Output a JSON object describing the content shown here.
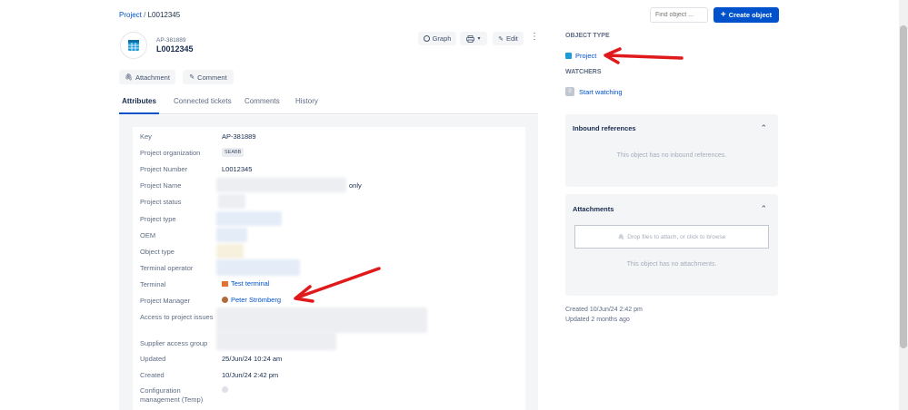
{
  "breadcrumb": {
    "parent": "Project",
    "separator": "/",
    "current": "L0012345"
  },
  "search": {
    "placeholder": "Find object ..."
  },
  "create_button": {
    "label": "Create object"
  },
  "object": {
    "key": "AP-381889",
    "name": "L0012345"
  },
  "toolbar": {
    "graph": "Graph",
    "edit": "Edit"
  },
  "actions": {
    "attachment": "Attachment",
    "comment": "Comment"
  },
  "tabs": [
    {
      "label": "Attributes",
      "active": true
    },
    {
      "label": "Connected tickets",
      "active": false
    },
    {
      "label": "Comments",
      "active": false
    },
    {
      "label": "History",
      "active": false
    }
  ],
  "attributes": {
    "key": {
      "label": "Key",
      "value": "AP-381889"
    },
    "org": {
      "label": "Project organization",
      "value": "SEABB"
    },
    "number": {
      "label": "Project Number",
      "value": "L0012345"
    },
    "name": {
      "label": "Project Name",
      "value_suffix": "only"
    },
    "status": {
      "label": "Project status"
    },
    "type": {
      "label": "Project type"
    },
    "oem": {
      "label": "OEM"
    },
    "object_type": {
      "label": "Object type"
    },
    "terminal_operator": {
      "label": "Terminal operator"
    },
    "terminal": {
      "label": "Terminal",
      "value": "Test terminal"
    },
    "manager": {
      "label": "Project Manager",
      "value": "Peter Strömberg"
    },
    "access": {
      "label": "Access to project issues"
    },
    "supplier": {
      "label": "Supplier access group"
    },
    "updated": {
      "label": "Updated",
      "value": "25/Jun/24 10:24 am"
    },
    "created": {
      "label": "Created",
      "value": "10/Jun/24 2:42 pm"
    },
    "config": {
      "label_line1": "Configuration",
      "label_line2": "management (Temp)"
    }
  },
  "sidebar": {
    "object_type_heading": "OBJECT TYPE",
    "object_type_value": "Project",
    "watchers_heading": "WATCHERS",
    "watch_count": "0",
    "start_watching": "Start watching",
    "inbound_title": "Inbound references",
    "inbound_empty": "This object has no inbound references.",
    "attachments_title": "Attachments",
    "drop_text": "Drop files to attach, or click to browse",
    "attachments_empty": "This object has no attachments.",
    "created_meta": "Created 10/Jun/24 2:42 pm",
    "updated_meta": "Updated 2 months ago"
  },
  "colors": {
    "brand": "#0052cc",
    "annotation_arrow": "#e0191b",
    "panel_bg": "#f4f5f7"
  }
}
